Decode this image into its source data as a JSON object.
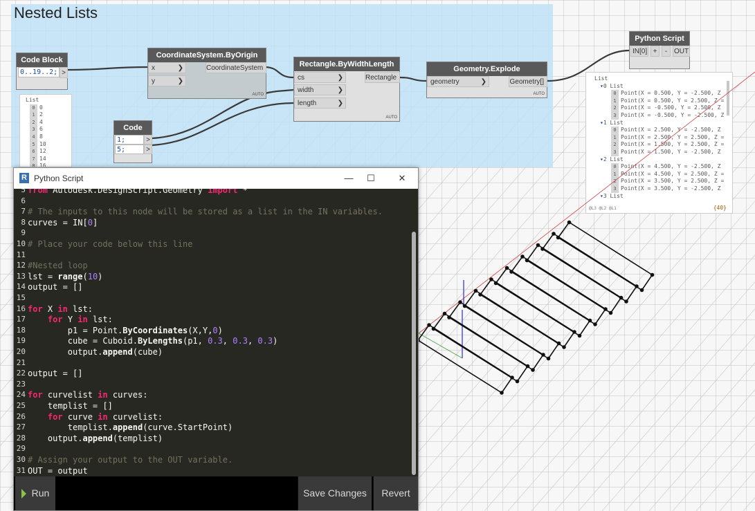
{
  "group": {
    "title": "Nested Lists"
  },
  "nodes": {
    "code_block_1": {
      "header": "Code Block",
      "code": "0..19..2;",
      "port_out": ">"
    },
    "code_block_2": {
      "header": "Code Block",
      "line1": "1;",
      "line2": "5;",
      "port_out": ">"
    },
    "coord_system": {
      "header": "CoordinateSystem.ByOrigin",
      "in_x": "x",
      "in_y": "y",
      "out": "CoordinateSystem",
      "lacing": "AUTO"
    },
    "rectangle": {
      "header": "Rectangle.ByWidthLength",
      "in_cs": "cs",
      "in_width": "width",
      "in_length": "length",
      "out": "Rectangle",
      "lacing": "AUTO"
    },
    "explode": {
      "header": "Geometry.Explode",
      "in_geometry": "geometry",
      "out": "Geometry[]",
      "lacing": "AUTO"
    },
    "python": {
      "header": "Python Script",
      "in": "IN[0]",
      "add": "+",
      "remove": "-",
      "out": "OUT"
    }
  },
  "watch_left": {
    "title": "List",
    "rows": [
      {
        "i": "0",
        "v": "0"
      },
      {
        "i": "1",
        "v": "2"
      },
      {
        "i": "2",
        "v": "4"
      },
      {
        "i": "3",
        "v": "6"
      },
      {
        "i": "4",
        "v": "8"
      },
      {
        "i": "5",
        "v": "10"
      },
      {
        "i": "6",
        "v": "12"
      },
      {
        "i": "7",
        "v": "14"
      },
      {
        "i": "8",
        "v": "16"
      }
    ]
  },
  "watch_right": {
    "title": "List",
    "footer": "@L3 @L2 @L1",
    "count": "{40}",
    "groups": [
      {
        "label": "0 List",
        "items": [
          {
            "i": "0",
            "v": "Point(X = 0.500, Y = -2.500, Z"
          },
          {
            "i": "1",
            "v": "Point(X = 0.500, Y = 2.500, Z ="
          },
          {
            "i": "2",
            "v": "Point(X = -0.500, Y = 2.500, Z"
          },
          {
            "i": "3",
            "v": "Point(X = -0.500, Y = -2.500, Z"
          }
        ]
      },
      {
        "label": "1 List",
        "items": [
          {
            "i": "0",
            "v": "Point(X = 2.500, Y = -2.500, Z"
          },
          {
            "i": "1",
            "v": "Point(X = 2.500, Y = 2.500, Z ="
          },
          {
            "i": "2",
            "v": "Point(X = 1.500, Y = 2.500, Z ="
          },
          {
            "i": "3",
            "v": "Point(X = 1.500, Y = -2.500, Z"
          }
        ]
      },
      {
        "label": "2 List",
        "items": [
          {
            "i": "0",
            "v": "Point(X = 4.500, Y = -2.500, Z"
          },
          {
            "i": "1",
            "v": "Point(X = 4.500, Y = 2.500, Z ="
          },
          {
            "i": "2",
            "v": "Point(X = 3.500, Y = 2.500, Z ="
          },
          {
            "i": "3",
            "v": "Point(X = 3.500, Y = -2.500, Z"
          }
        ]
      },
      {
        "label": "3 List",
        "items": []
      }
    ]
  },
  "editor_window": {
    "title": "Python Script",
    "minimize": "—",
    "maximize": "☐",
    "close": "✕",
    "lines": [
      {
        "n": "5",
        "tokens": [
          [
            "kw",
            "from"
          ],
          [
            "t",
            " Autodesk.DesignScript.Geometry "
          ],
          [
            "kw",
            "import"
          ],
          [
            "t",
            " *"
          ]
        ]
      },
      {
        "n": "6",
        "tokens": []
      },
      {
        "n": "7",
        "tokens": [
          [
            "cm",
            "# The inputs to this node will be stored as a list in the IN variables."
          ]
        ]
      },
      {
        "n": "8",
        "tokens": [
          [
            "t",
            "curves = IN["
          ],
          [
            "num",
            "0"
          ],
          [
            "t",
            "]"
          ]
        ]
      },
      {
        "n": "9",
        "tokens": []
      },
      {
        "n": "10",
        "tokens": [
          [
            "cm",
            "# Place your code below this line"
          ]
        ]
      },
      {
        "n": "11",
        "tokens": []
      },
      {
        "n": "12",
        "tokens": [
          [
            "cm",
            "#Nested loop"
          ]
        ]
      },
      {
        "n": "13",
        "tokens": [
          [
            "t",
            "lst = "
          ],
          [
            "fn",
            "range"
          ],
          [
            "t",
            "("
          ],
          [
            "num",
            "10"
          ],
          [
            "t",
            ")"
          ]
        ]
      },
      {
        "n": "14",
        "tokens": [
          [
            "t",
            "output = []"
          ]
        ]
      },
      {
        "n": "15",
        "tokens": []
      },
      {
        "n": "16",
        "tokens": [
          [
            "kw",
            "for"
          ],
          [
            "t",
            " X "
          ],
          [
            "kw",
            "in"
          ],
          [
            "t",
            " lst:"
          ]
        ]
      },
      {
        "n": "17",
        "tokens": [
          [
            "t",
            "    "
          ],
          [
            "kw",
            "for"
          ],
          [
            "t",
            " Y "
          ],
          [
            "kw",
            "in"
          ],
          [
            "t",
            " lst:"
          ]
        ]
      },
      {
        "n": "18",
        "tokens": [
          [
            "t",
            "        p1 = Point."
          ],
          [
            "fn",
            "ByCoordinates"
          ],
          [
            "t",
            "(X,Y,"
          ],
          [
            "num",
            "0"
          ],
          [
            "t",
            ")"
          ]
        ]
      },
      {
        "n": "19",
        "tokens": [
          [
            "t",
            "        cube = Cuboid."
          ],
          [
            "fn",
            "ByLengths"
          ],
          [
            "t",
            "(p1, "
          ],
          [
            "num",
            "0.3"
          ],
          [
            "t",
            ", "
          ],
          [
            "num",
            "0.3"
          ],
          [
            "t",
            ", "
          ],
          [
            "num",
            "0.3"
          ],
          [
            "t",
            ")"
          ]
        ]
      },
      {
        "n": "20",
        "tokens": [
          [
            "t",
            "        output."
          ],
          [
            "fn",
            "append"
          ],
          [
            "t",
            "(cube)"
          ]
        ]
      },
      {
        "n": "21",
        "tokens": []
      },
      {
        "n": "22",
        "tokens": [
          [
            "t",
            "output = []"
          ]
        ]
      },
      {
        "n": "23",
        "tokens": []
      },
      {
        "n": "24",
        "tokens": [
          [
            "kw",
            "for"
          ],
          [
            "t",
            " curvelist "
          ],
          [
            "kw",
            "in"
          ],
          [
            "t",
            " curves:"
          ]
        ]
      },
      {
        "n": "25",
        "tokens": [
          [
            "t",
            "    templist = []"
          ]
        ]
      },
      {
        "n": "26",
        "tokens": [
          [
            "t",
            "    "
          ],
          [
            "kw",
            "for"
          ],
          [
            "t",
            " curve "
          ],
          [
            "kw",
            "in"
          ],
          [
            "t",
            " curvelist:"
          ]
        ]
      },
      {
        "n": "27",
        "tokens": [
          [
            "t",
            "        templist."
          ],
          [
            "fn",
            "append"
          ],
          [
            "t",
            "(curve.StartPoint)"
          ]
        ]
      },
      {
        "n": "28",
        "tokens": [
          [
            "t",
            "    output."
          ],
          [
            "fn",
            "append"
          ],
          [
            "t",
            "(templist)"
          ]
        ]
      },
      {
        "n": "29",
        "tokens": []
      },
      {
        "n": "30",
        "tokens": [
          [
            "cm",
            "# Assign your output to the OUT variable."
          ]
        ]
      },
      {
        "n": "31",
        "tokens": [
          [
            "t",
            "OUT = output"
          ]
        ]
      }
    ],
    "run_label": "Run",
    "save_label": "Save Changes",
    "revert_label": "Revert"
  }
}
